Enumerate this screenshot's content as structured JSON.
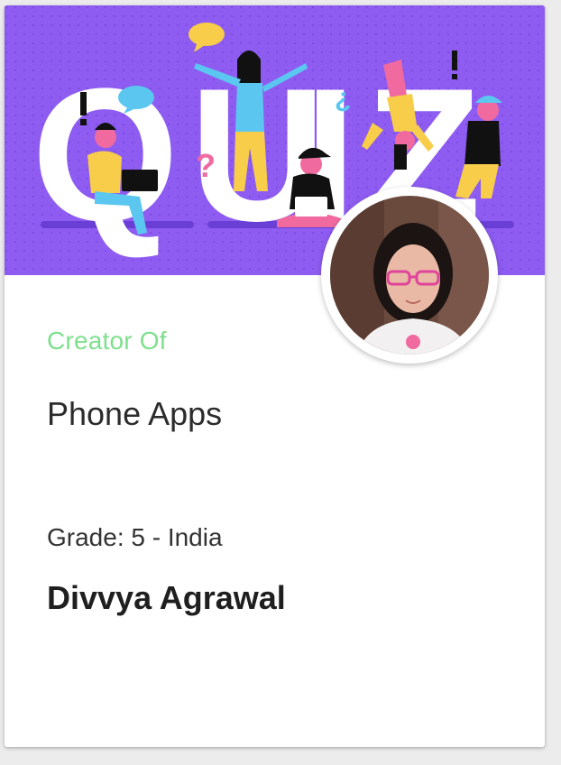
{
  "banner": {
    "title_letters": [
      "Q",
      "U",
      "I",
      "Z"
    ],
    "background_color": "#8e5cf0",
    "image_name": "quiz-illustration"
  },
  "profile": {
    "avatar_icon": "profile-photo",
    "role_label": "Creator Of",
    "topic": "Phone Apps",
    "grade": "Grade: 5 - India",
    "name": "Divvya Agrawal"
  },
  "colors": {
    "accent_green": "#7ee08d",
    "banner_purple": "#8e5cf0",
    "text_dark": "#1f1f1f"
  }
}
